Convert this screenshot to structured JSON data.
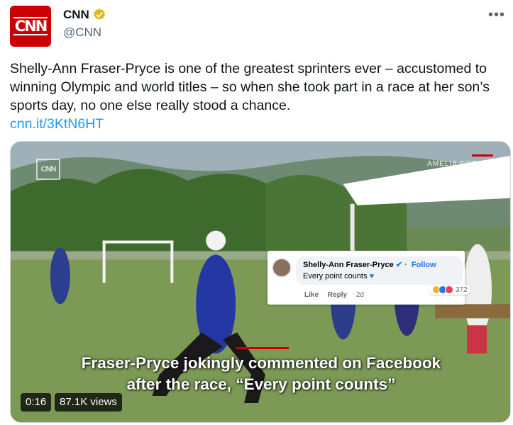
{
  "account": {
    "display_name": "CNN",
    "handle": "@CNN",
    "avatar_text": "CNN",
    "verified": true
  },
  "more_icon": "more-horizontal-icon",
  "tweet": {
    "text": "Shelly-Ann Fraser-Pryce is one of the greatest sprinters ever – accustomed to winning Olympic and world titles – so when she took part in a race at her son’s sports day, no one else really stood a chance.",
    "link": "cnn.it/3KtN6HT"
  },
  "media": {
    "watermark": "CNN",
    "credit": "AMELIA GORDON",
    "facebook_comment": {
      "name": "Shelly-Ann Fraser-Pryce",
      "follow": "Follow",
      "comment": "Every point counts",
      "actions": [
        "Like",
        "Reply"
      ],
      "time": "2d",
      "reaction_count": "372"
    },
    "caption_line1": "Fraser-Pryce jokingly commented on Facebook",
    "caption_line2": "after the race, “Every point counts”",
    "timestamp": "0:16",
    "views": "87.1K views"
  },
  "colors": {
    "brand_red": "#cc0000",
    "link_blue": "#1d9bf0",
    "verified_gold": "#e2b719"
  }
}
